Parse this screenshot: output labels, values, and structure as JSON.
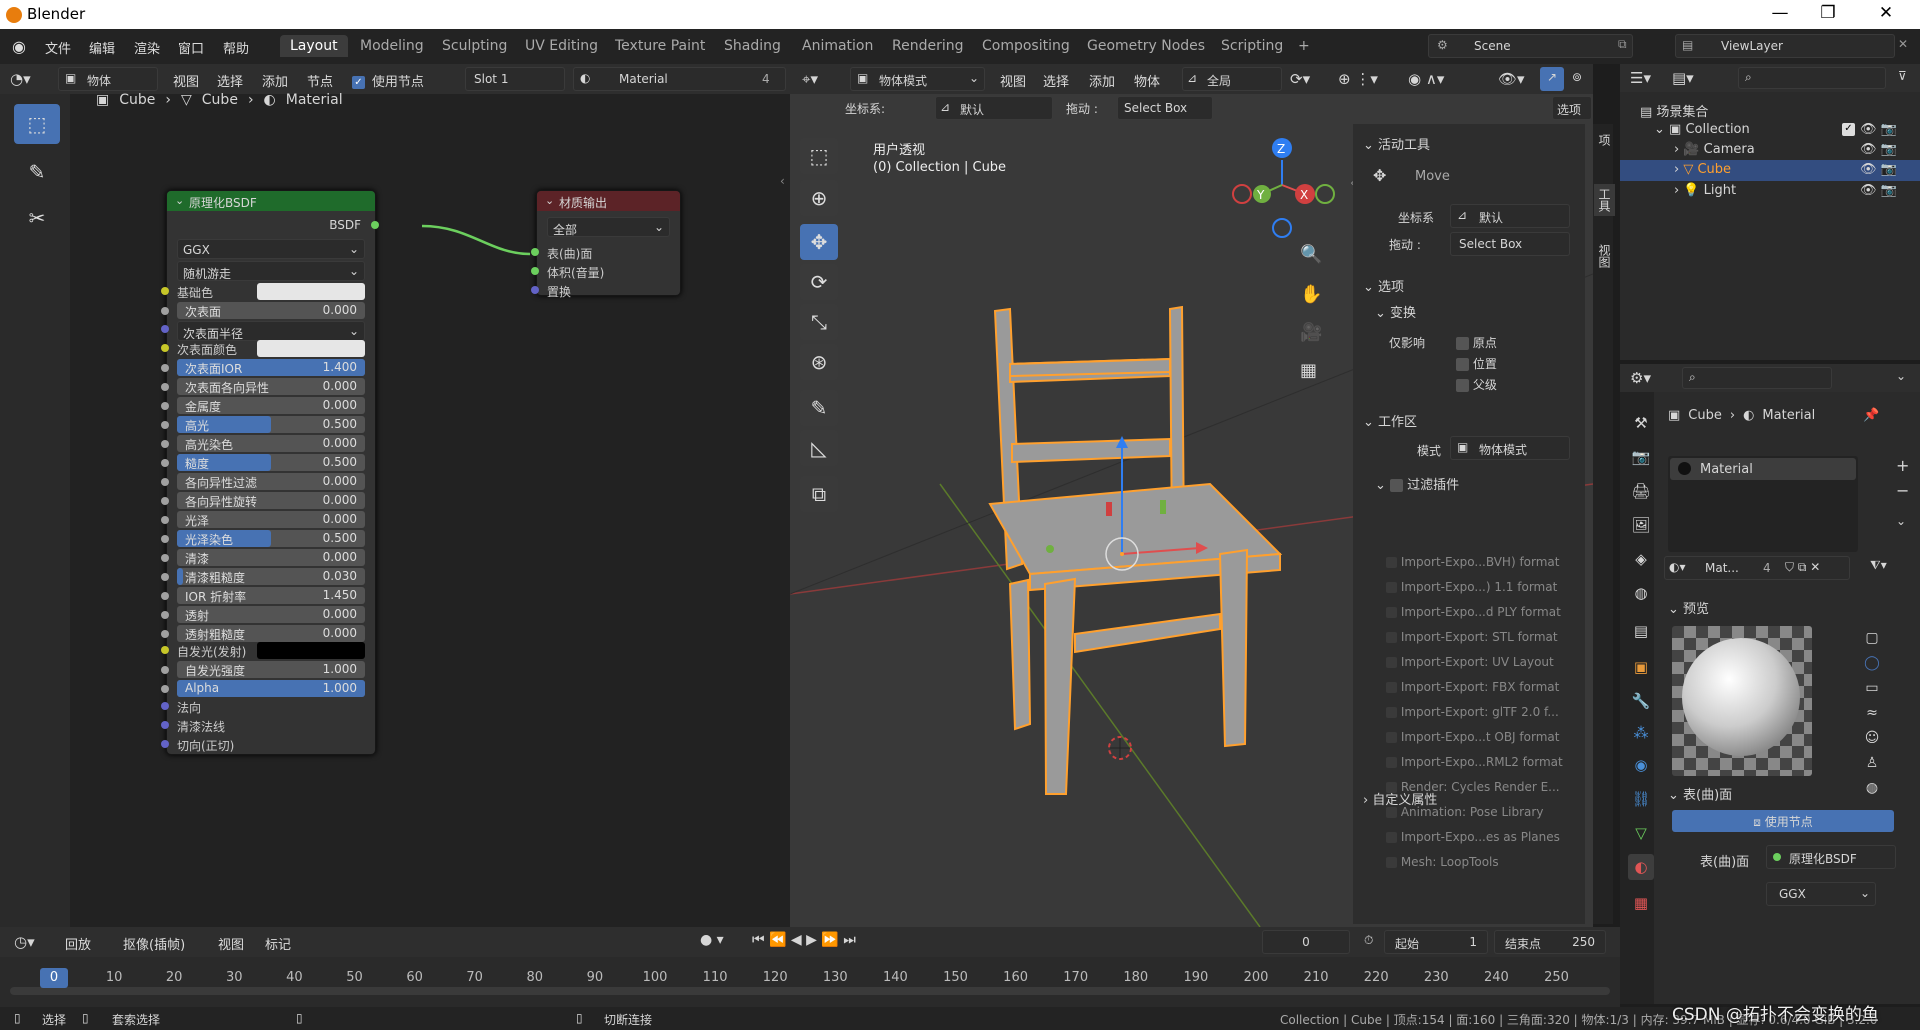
{
  "app_title": "Blender",
  "menus": [
    "文件",
    "编辑",
    "渲染",
    "窗口",
    "帮助"
  ],
  "workspaces": [
    "Layout",
    "Modeling",
    "Sculpting",
    "UV Editing",
    "Texture Paint",
    "Shading",
    "Animation",
    "Rendering",
    "Compositing",
    "Geometry Nodes",
    "Scripting"
  ],
  "add_tab": "+",
  "scene": "Scene",
  "view_layer": "ViewLayer",
  "node_editor": {
    "header": {
      "mode": "物体",
      "menus": [
        "视图",
        "选择",
        "添加",
        "节点"
      ],
      "use_nodes": "使用节点",
      "slot": "Slot 1",
      "material": "Material",
      "users": "4"
    },
    "breadcrumb": [
      "Cube",
      "Cube",
      "Material"
    ],
    "bsdf": {
      "title": "原理化BSDF",
      "output": "BSDF",
      "distribution": "GGX",
      "subsurface_method": "随机游走",
      "base_color": "基础色",
      "subsurface_radius": "次表面半径",
      "subsurface_color": "次表面颜色",
      "emission": "自发光(发射)",
      "sliders": [
        {
          "label": "次表面",
          "value": "0.000",
          "fill": 0
        },
        {
          "label": "次表面IOR",
          "value": "1.400",
          "fill": 1
        },
        {
          "label": "次表面各向异性",
          "value": "0.000",
          "fill": 0
        },
        {
          "label": "金属度",
          "value": "0.000",
          "fill": 0
        },
        {
          "label": "高光",
          "value": "0.500",
          "fill": 0.5
        },
        {
          "label": "高光染色",
          "value": "0.000",
          "fill": 0
        },
        {
          "label": "糙度",
          "value": "0.500",
          "fill": 0.5
        },
        {
          "label": "各向异性过滤",
          "value": "0.000",
          "fill": 0
        },
        {
          "label": "各向异性旋转",
          "value": "0.000",
          "fill": 0
        },
        {
          "label": "光泽",
          "value": "0.000",
          "fill": 0
        },
        {
          "label": "光泽染色",
          "value": "0.500",
          "fill": 0.5
        },
        {
          "label": "清漆",
          "value": "0.000",
          "fill": 0
        },
        {
          "label": "清漆粗糙度",
          "value": "0.030",
          "fill": 0.03
        },
        {
          "label": "IOR 折射率",
          "value": "1.450",
          "fill": 0
        },
        {
          "label": "透射",
          "value": "0.000",
          "fill": 0
        },
        {
          "label": "透射粗糙度",
          "value": "0.000",
          "fill": 0
        }
      ],
      "emission_strength": {
        "label": "自发光强度",
        "value": "1.000",
        "fill": 0
      },
      "alpha": {
        "label": "Alpha",
        "value": "1.000",
        "fill": 1
      },
      "inputs": [
        "法向",
        "清漆法线",
        "切向(正切)"
      ]
    },
    "output": {
      "title": "材质输出",
      "target": "全部",
      "sockets": [
        "表(曲)面",
        "体积(音量)",
        "置换"
      ]
    }
  },
  "viewport": {
    "mode": "物体模式",
    "menus": [
      "视图",
      "选择",
      "添加",
      "物体"
    ],
    "transform": "全局",
    "orient_label": "坐标系:",
    "orient_value": "默认",
    "drag_label": "拖动 :",
    "drag_value": "Select Box",
    "options": "选项",
    "view_name": "用户透视",
    "view_sub": "(0) Collection | Cube"
  },
  "ntabs": [
    "项",
    "工具",
    "视图"
  ],
  "tool_panel": {
    "active_tool": "活动工具",
    "tool": "Move",
    "orient_label": "坐标系",
    "orient_value": "默认",
    "drag_label": "拖动 :",
    "drag_value": "Select Box",
    "options": "选项",
    "transform": "变换",
    "affect": "仅影响",
    "origin": "原点",
    "location": "位置",
    "parent": "父级",
    "workspace": "工作区",
    "mode_label": "模式",
    "mode_value": "物体模式",
    "filter_addons": "过滤插件",
    "addons": [
      "Import-Expo...BVH) format",
      "Import-Expo...) 1.1 format",
      "Import-Expo...d PLY format",
      "Import-Export: STL format",
      "Import-Export: UV Layout",
      "Import-Export: FBX format",
      "Import-Export: glTF 2.0 f...",
      "Import-Expo...t OBJ format",
      "Import-Expo...RML2 format",
      "Render: Cycles Render E...",
      "Animation: Pose Library",
      "Import-Expo...es as Planes",
      "Mesh: LoopTools"
    ],
    "custom_props": "自定义属性"
  },
  "outliner": {
    "root": "场景集合",
    "collection": "Collection",
    "items": [
      "Camera",
      "Cube",
      "Light"
    ]
  },
  "properties": {
    "breadcrumb": [
      "Cube",
      "Material"
    ],
    "slot": "Material",
    "mat_name": "Mat...",
    "users": "4",
    "preview": "预览",
    "surface": "表(曲)面",
    "use_nodes": "使用节点",
    "surface_label": "表(曲)面",
    "surface_value": "原理化BSDF",
    "dist": "GGX"
  },
  "timeline": {
    "menus": [
      "回放",
      "抠像(插帧)",
      "视图",
      "标记"
    ],
    "current_frame": "0",
    "start_label": "起始",
    "start": "1",
    "end_label": "结束点",
    "end": "250",
    "ticks": [
      "0",
      "10",
      "20",
      "30",
      "40",
      "50",
      "60",
      "70",
      "80",
      "90",
      "100",
      "110",
      "120",
      "130",
      "140",
      "150",
      "160",
      "170",
      "180",
      "190",
      "200",
      "210",
      "220",
      "230",
      "240",
      "250"
    ]
  },
  "statusbar": {
    "select": "选择",
    "lasso": "套索选择",
    "cut": "切断连接",
    "info": "Collection | Cube | 顶点:154 | 面:160 | 三角面:320 | 物体:1/3 | 内存: 39.7 MiB | 显存: 0.6/4.0 GiB | 3.2.0"
  },
  "watermark": "CSDN @拓扑不会变换的鱼",
  "colors": {
    "accent": "#4772b3",
    "selected": "#ffa02e",
    "node_green": "#1f6b2b",
    "node_red": "#6b2525"
  }
}
